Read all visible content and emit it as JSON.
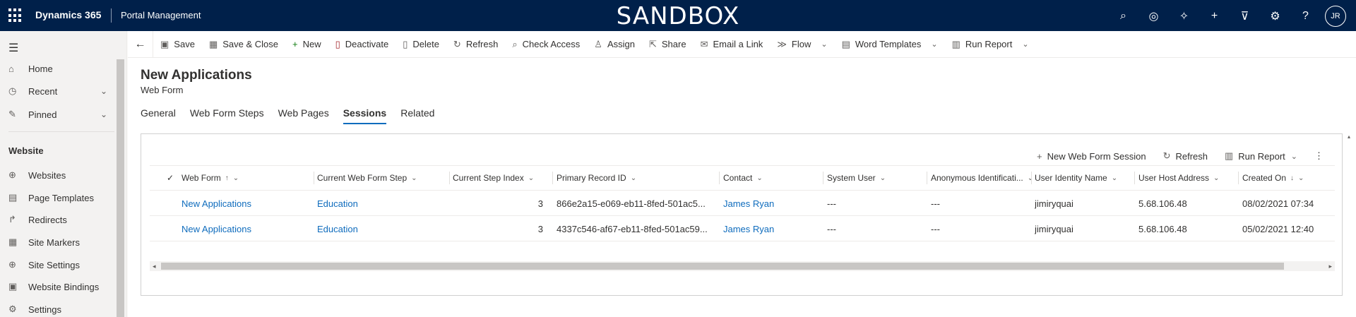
{
  "topbar": {
    "app_name": "Dynamics 365",
    "module": "Portal Management",
    "environment": "SANDBOX",
    "avatar_initials": "JR",
    "icons": [
      "search-icon",
      "task-icon",
      "lightbulb-icon",
      "plus-icon",
      "filter-icon",
      "gear-icon",
      "help-icon"
    ]
  },
  "sidebar": {
    "items": [
      {
        "label": "Home",
        "icon": "home-icon"
      },
      {
        "label": "Recent",
        "icon": "clock-icon"
      },
      {
        "label": "Pinned",
        "icon": "pin-icon"
      }
    ],
    "section": "Website",
    "section_items": [
      {
        "label": "Websites",
        "icon": "globe-icon"
      },
      {
        "label": "Page Templates",
        "icon": "document-icon"
      },
      {
        "label": "Redirects",
        "icon": "redirect-icon"
      },
      {
        "label": "Site Markers",
        "icon": "marker-icon"
      },
      {
        "label": "Site Settings",
        "icon": "settings-icon"
      },
      {
        "label": "Website Bindings",
        "icon": "binding-icon"
      },
      {
        "label": "Settings",
        "icon": "gear-icon"
      }
    ]
  },
  "commandbar": {
    "save": "Save",
    "save_close": "Save & Close",
    "new": "New",
    "deactivate": "Deactivate",
    "delete": "Delete",
    "refresh": "Refresh",
    "check_access": "Check Access",
    "assign": "Assign",
    "share": "Share",
    "email_link": "Email a Link",
    "flow": "Flow",
    "word_templates": "Word Templates",
    "run_report": "Run Report"
  },
  "record": {
    "title": "New Applications",
    "entity": "Web Form"
  },
  "tabs": [
    "General",
    "Web Form Steps",
    "Web Pages",
    "Sessions",
    "Related"
  ],
  "active_tab": "Sessions",
  "grid": {
    "commands": {
      "new_session": "New Web Form Session",
      "refresh": "Refresh",
      "run_report": "Run Report"
    },
    "columns": [
      "Web Form",
      "Current Web Form Step",
      "Current Step Index",
      "Primary Record ID",
      "Contact",
      "System User",
      "Anonymous Identificati...",
      "User Identity Name",
      "User Host Address",
      "Created On"
    ],
    "rows": [
      {
        "web_form": "New Applications",
        "step": "Education",
        "index": "3",
        "record_id": "866e2a15-e069-eb11-8fed-501ac5...",
        "contact": "James Ryan",
        "system_user": "---",
        "anon": "---",
        "identity": "jimiryquai",
        "host": "5.68.106.48",
        "created": "08/02/2021 07:34"
      },
      {
        "web_form": "New Applications",
        "step": "Education",
        "index": "3",
        "record_id": "4337c546-af67-eb11-8fed-501ac59...",
        "contact": "James Ryan",
        "system_user": "---",
        "anon": "---",
        "identity": "jimiryquai",
        "host": "5.68.106.48",
        "created": "05/02/2021 12:40"
      }
    ]
  }
}
